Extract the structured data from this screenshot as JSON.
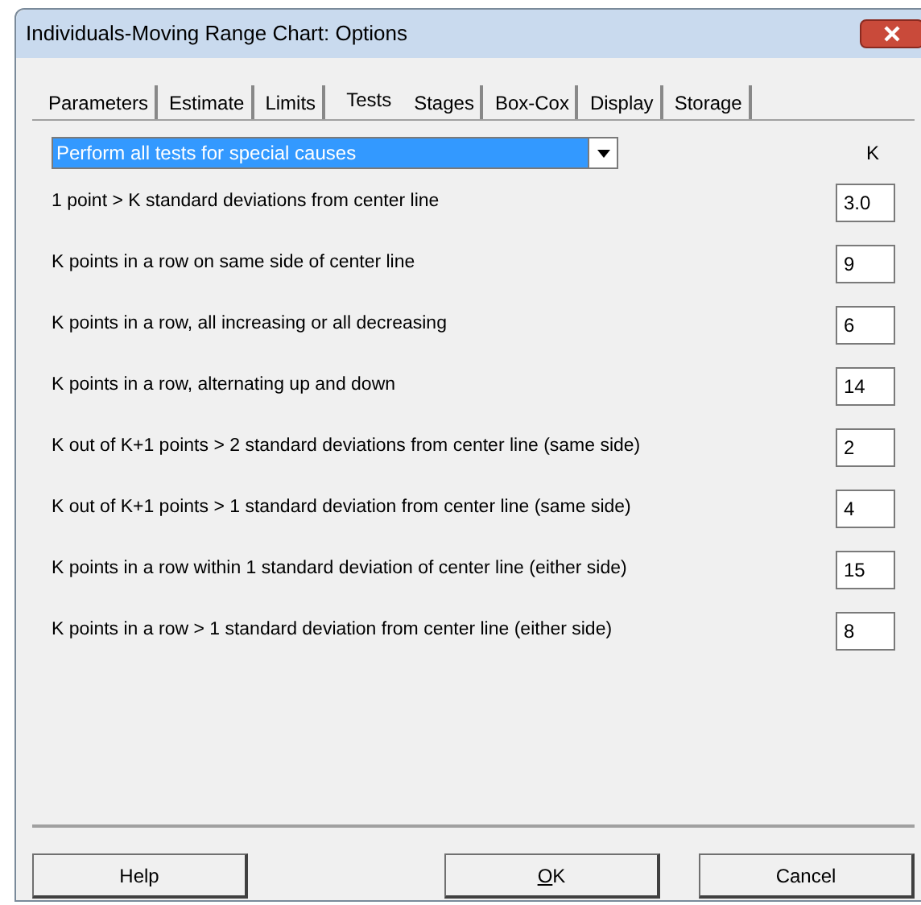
{
  "window": {
    "title": "Individuals-Moving Range Chart: Options"
  },
  "tabs": [
    {
      "label": "Parameters",
      "selected": false
    },
    {
      "label": "Estimate",
      "selected": false
    },
    {
      "label": "Limits",
      "selected": false
    },
    {
      "label": "Tests",
      "selected": true
    },
    {
      "label": "Stages",
      "selected": false
    },
    {
      "label": "Box-Cox",
      "selected": false
    },
    {
      "label": "Display",
      "selected": false
    },
    {
      "label": "Storage",
      "selected": false
    }
  ],
  "test_mode": {
    "value": "Perform all tests for special causes"
  },
  "k_header": "K",
  "tests": [
    {
      "label": "1 point > K standard deviations from center line",
      "value": "3.0"
    },
    {
      "label": "K points in a row on same side of center line",
      "value": "9"
    },
    {
      "label": "K points in a row, all increasing or all decreasing",
      "value": "6"
    },
    {
      "label": "K points in a row, alternating up and down",
      "value": "14"
    },
    {
      "label": "K out of K+1 points > 2 standard deviations from center line (same side)",
      "value": "2"
    },
    {
      "label": "K out of K+1 points > 1 standard deviation from center line (same side)",
      "value": "4"
    },
    {
      "label": "K points in a row within 1 standard deviation of center line (either side)",
      "value": "15"
    },
    {
      "label": "K points in a row > 1 standard deviation from center line (either side)",
      "value": "8"
    }
  ],
  "buttons": [
    {
      "label": "Help",
      "kind": "left",
      "underline_first": false
    },
    {
      "label": "OK",
      "kind": "right",
      "underline_first": true
    },
    {
      "label": "Cancel",
      "kind": "right",
      "underline_first": false
    }
  ]
}
